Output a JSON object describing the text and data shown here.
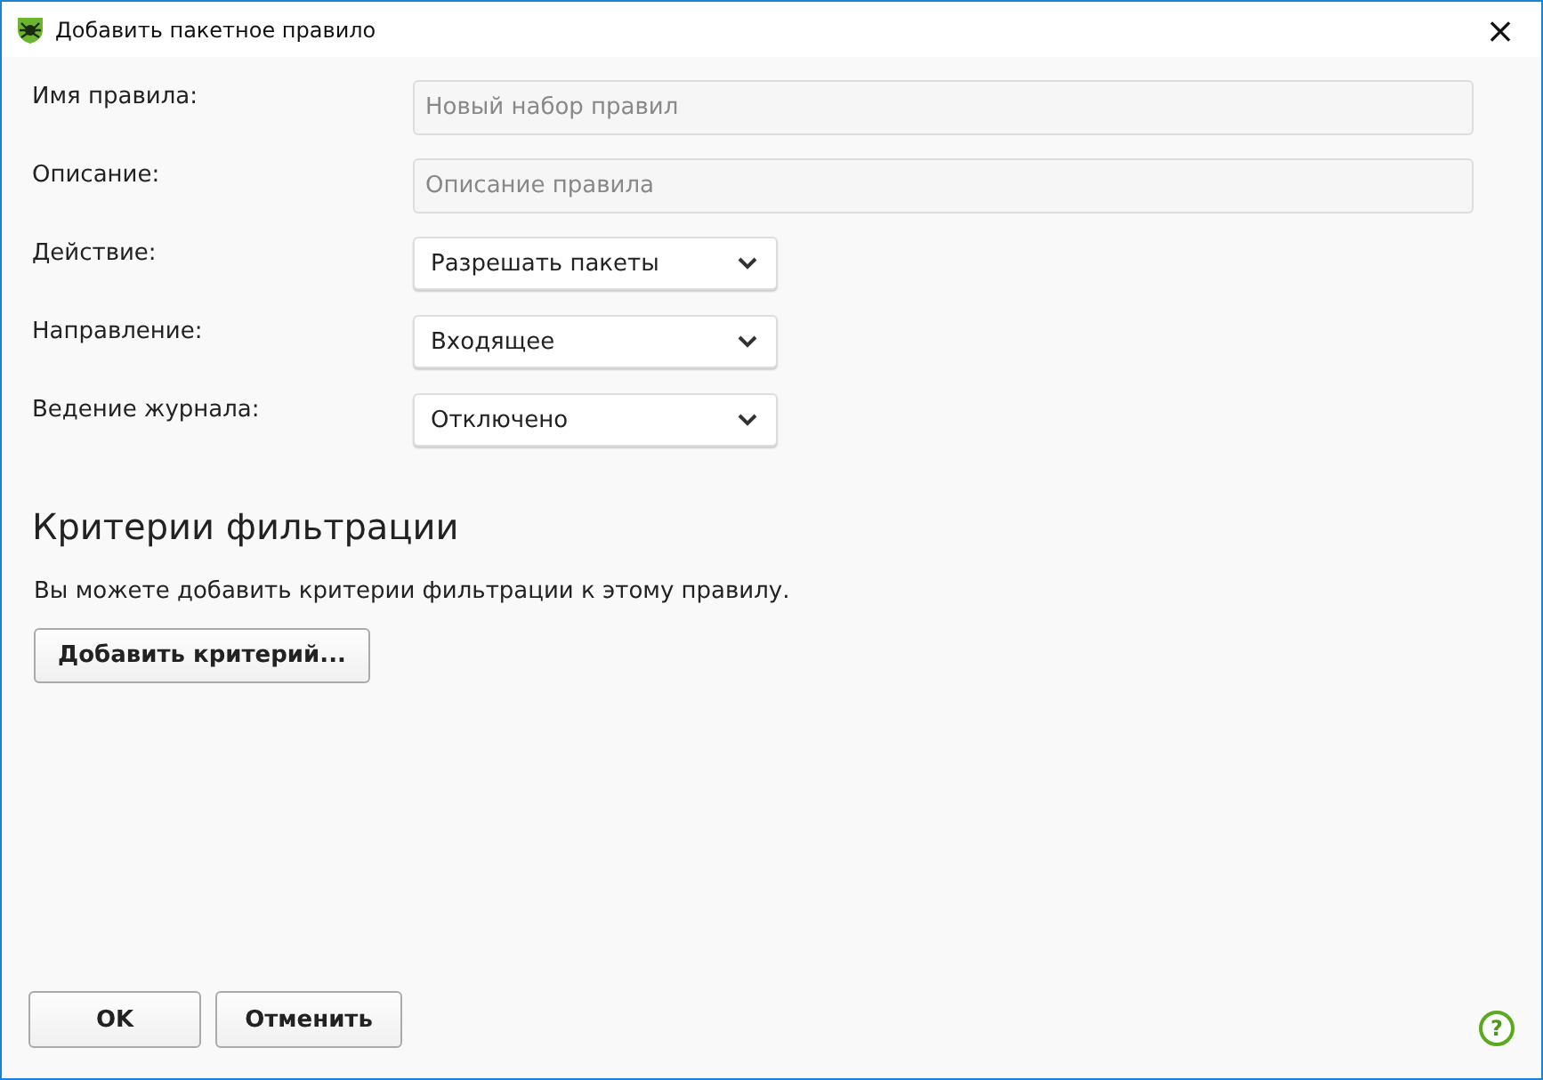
{
  "window": {
    "title": "Добавить пакетное правило",
    "close": "×"
  },
  "fields": [
    {
      "kind": "text",
      "label": "Имя правила:",
      "placeholder": "Новый набор правил"
    },
    {
      "kind": "text",
      "label": "Описание:",
      "placeholder": "Описание правила"
    },
    {
      "kind": "select",
      "label": "Действие:",
      "value": "Разрешать пакеты"
    },
    {
      "kind": "select",
      "label": "Направление:",
      "value": "Входящее"
    },
    {
      "kind": "select",
      "label": "Ведение журнала:",
      "value": "Отключено"
    }
  ],
  "criteria": {
    "heading": "Критерии фильтрации",
    "description": "Вы можете добавить критерии фильтрации к этому правилу.",
    "button": "Добавить критерий..."
  },
  "buttons": [
    "OK",
    "Отменить"
  ],
  "help": "?"
}
